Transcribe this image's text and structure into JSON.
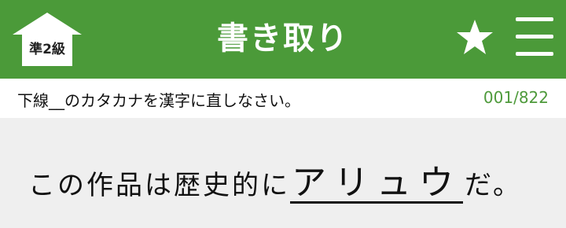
{
  "header": {
    "home_label": "準2級",
    "title": "書き取り",
    "icons": {
      "home": "home-icon",
      "star": "star-icon",
      "menu": "menu-icon"
    },
    "colors": {
      "accent": "#4b9a39",
      "counter": "#4e9a3b"
    }
  },
  "instruction": {
    "text": "下線__のカタカナを漢字に直しなさい。",
    "counter": "001/822"
  },
  "question": {
    "before": "この作品は歴史的に",
    "target": "アリュウ",
    "after": "だ。"
  }
}
